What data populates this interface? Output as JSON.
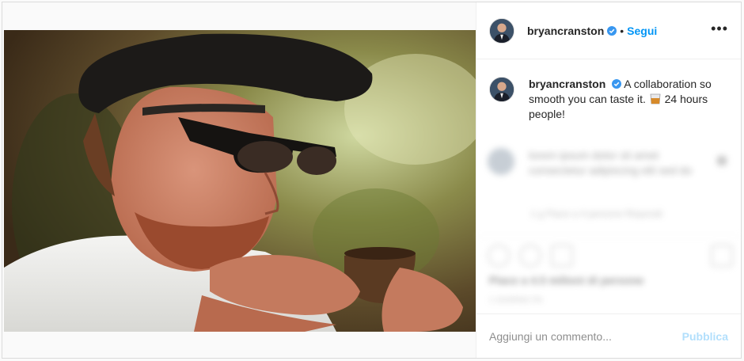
{
  "post": {
    "header": {
      "username": "bryancranston",
      "separator": "•",
      "follow_label": "Segui",
      "more_label": "•••"
    },
    "caption": {
      "username": "bryancranston",
      "text_before_emoji": "A collaboration so smooth you can taste it.",
      "text_after_emoji": "24 hours people!"
    },
    "blurred_comment": {
      "text": "lorem ipsum dolor sit amet consectetur adipiscing elit sed do",
      "meta": "1 g   Piace a 4 persone   Rispondi"
    },
    "likes_text": "Piace a 4.5 milioni di persone",
    "date_text": "1 GIORNO FA",
    "add_comment": {
      "placeholder": "Aggiungi un commento...",
      "publish_label": "Pubblica"
    },
    "colors": {
      "link_blue": "#0095f6",
      "publish_disabled": "#b2dffc",
      "verified_badge": "#3897f0"
    },
    "icons": [
      "verified-badge-icon",
      "more-options-icon",
      "whiskey-glass-icon",
      "heart-icon",
      "comment-icon",
      "share-icon",
      "bookmark-icon"
    ]
  }
}
